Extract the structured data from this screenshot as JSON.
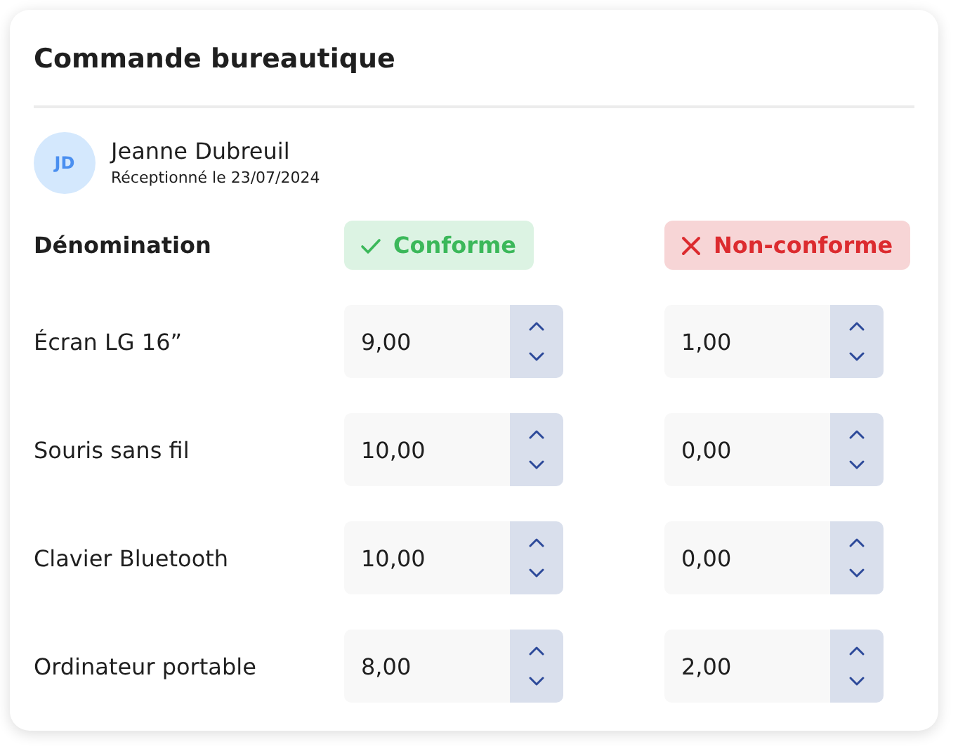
{
  "title": "Commande bureautique",
  "user": {
    "initials": "JD",
    "name": "Jeanne Dubreuil",
    "subtitle": "Réceptionné le 23/07/2024"
  },
  "columns": [
    {
      "kind": "name",
      "label": "Dénomination"
    },
    {
      "kind": "ok",
      "label": "Conforme"
    },
    {
      "kind": "nok",
      "label": "Non-conforme"
    }
  ],
  "rows": [
    {
      "name": "Écran LG 16”",
      "conforme": "9,00",
      "non_conforme": "1,00"
    },
    {
      "name": "Souris sans fil",
      "conforme": "10,00",
      "non_conforme": "0,00"
    },
    {
      "name": "Clavier Bluetooth",
      "conforme": "10,00",
      "non_conforme": "0,00"
    },
    {
      "name": "Ordinateur portable",
      "conforme": "8,00",
      "non_conforme": "2,00"
    }
  ]
}
